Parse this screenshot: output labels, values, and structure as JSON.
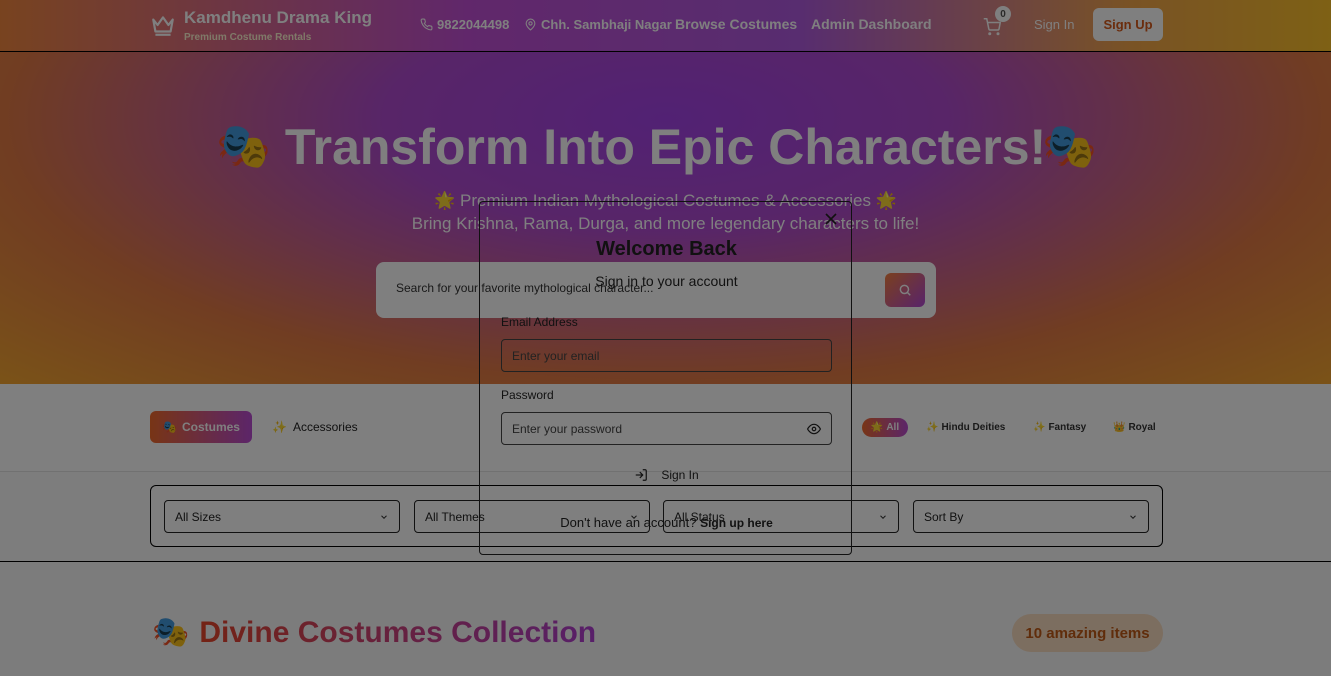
{
  "header": {
    "brand_title": "Kamdhenu Drama King",
    "brand_subtitle": "Premium Costume Rentals",
    "phone": "9822044498",
    "location": "Chh. Sambhaji Nagar",
    "nav_browse": "Browse Costumes",
    "nav_admin": "Admin Dashboard",
    "cart_count": "0",
    "sign_in": "Sign In",
    "sign_up": "Sign Up"
  },
  "hero": {
    "title": "Transform Into Epic Characters!",
    "mask_emoji": "🎭",
    "subtitle_line1": "🌟 Premium Indian Mythological Costumes & Accessories 🌟",
    "subtitle_line2": "Bring Krishna, Rama, Durga, and more legendary characters to life!",
    "search_placeholder": "Search for your favorite mythological character..."
  },
  "tabs": {
    "costumes_icon": "🎭",
    "costumes": "Costumes",
    "accessories_icon": "✨",
    "accessories": "Accessories"
  },
  "chips": [
    {
      "icon": "🌟",
      "label": "All"
    },
    {
      "icon": "✨",
      "label": "Hindu Deities"
    },
    {
      "icon": "✨",
      "label": "Fantasy"
    },
    {
      "icon": "👑",
      "label": "Royal"
    }
  ],
  "filters": {
    "sizes": "All Sizes",
    "themes": "All Themes",
    "status": "All Status",
    "sort": "Sort By"
  },
  "collection": {
    "emoji": "🎭",
    "title": "Divine Costumes Collection",
    "count_badge": "10 amazing items"
  },
  "modal": {
    "title": "Welcome Back",
    "subtitle": "Sign in to your account",
    "email_label": "Email Address",
    "email_placeholder": "Enter your email",
    "password_label": "Password",
    "password_placeholder": "Enter your password",
    "submit": "Sign In",
    "footer_text": "Don't have an account?",
    "footer_link": "Sign up here"
  }
}
